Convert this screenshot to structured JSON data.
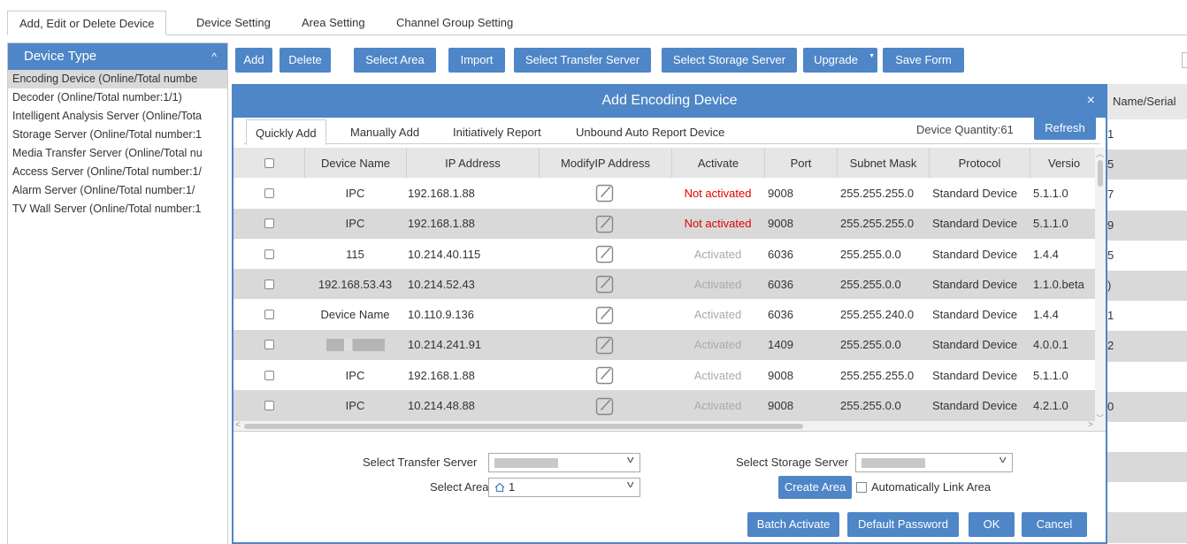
{
  "top_tabs": [
    "Add, Edit or Delete Device",
    "Device Setting",
    "Area Setting",
    "Channel Group Setting"
  ],
  "left_panel": {
    "title": "Device Type",
    "items": [
      "Encoding Device (Online/Total numbe",
      "Decoder (Online/Total number:1/1)",
      "Intelligent Analysis Server (Online/Tota",
      "Storage Server (Online/Total number:1",
      "Media Transfer Server (Online/Total nu",
      "Access Server (Online/Total number:1/",
      "Alarm Server (Online/Total number:1/",
      "TV Wall Server (Online/Total number:1"
    ]
  },
  "toolbar": {
    "add": "Add",
    "delete": "Delete",
    "select_area": "Select Area",
    "import": "Import",
    "select_transfer_server": "Select Transfer Server",
    "select_storage_server": "Select Storage Server",
    "upgrade": "Upgrade",
    "save_form": "Save Form"
  },
  "background_table": {
    "header": "Name/Serial",
    "rows": [
      "1",
      "5",
      "7",
      "9",
      "5",
      ")",
      "1",
      "2",
      "",
      "0"
    ]
  },
  "dialog": {
    "title": "Add  Encoding Device",
    "close": "×",
    "tabs": [
      "Quickly Add",
      "Manually Add",
      "Initiatively Report",
      "Unbound Auto Report Device"
    ],
    "device_quantity": "Device Quantity:61",
    "refresh": "Refresh",
    "columns": [
      "Device Name",
      "IP Address",
      "ModifyIP Address",
      "Activate",
      "Port",
      "Subnet Mask",
      "Protocol",
      "Versio"
    ],
    "rows": [
      {
        "name": "IPC",
        "ip": "192.168.1.88",
        "activate": "Not activated",
        "active": false,
        "port": "9008",
        "mask": "255.255.255.0",
        "protocol": "Standard Device",
        "version": "5.1.1.0"
      },
      {
        "name": "IPC",
        "ip": "192.168.1.88",
        "activate": "Not activated",
        "active": false,
        "port": "9008",
        "mask": "255.255.255.0",
        "protocol": "Standard Device",
        "version": "5.1.1.0"
      },
      {
        "name": "115",
        "ip": "10.214.40.115",
        "activate": "Activated",
        "active": true,
        "port": "6036",
        "mask": "255.255.0.0",
        "protocol": "Standard Device",
        "version": "1.4.4"
      },
      {
        "name": "192.168.53.43",
        "ip": "10.214.52.43",
        "activate": "Activated",
        "active": true,
        "port": "6036",
        "mask": "255.255.0.0",
        "protocol": "Standard Device",
        "version": "1.1.0.beta"
      },
      {
        "name": "Device Name",
        "ip": "10.110.9.136",
        "activate": "Activated",
        "active": true,
        "port": "6036",
        "mask": "255.255.240.0",
        "protocol": "Standard Device",
        "version": "1.4.4"
      },
      {
        "name": "",
        "ip": "10.214.241.91",
        "activate": "Activated",
        "active": true,
        "port": "1409",
        "mask": "255.255.0.0",
        "protocol": "Standard Device",
        "version": "4.0.0.1"
      },
      {
        "name": "IPC",
        "ip": "192.168.1.88",
        "activate": "Activated",
        "active": true,
        "port": "9008",
        "mask": "255.255.255.0",
        "protocol": "Standard Device",
        "version": "5.1.1.0"
      },
      {
        "name": "IPC",
        "ip": "10.214.48.88",
        "activate": "Activated",
        "active": true,
        "port": "9008",
        "mask": "255.255.0.0",
        "protocol": "Standard Device",
        "version": "4.2.1.0"
      }
    ],
    "form": {
      "transfer_label": "Select Transfer Server",
      "storage_label": "Select Storage Server",
      "area_label": "Select Area",
      "area_value": "1",
      "create_area": "Create Area",
      "auto_link": "Automatically Link Area"
    },
    "buttons": {
      "batch_activate": "Batch Activate",
      "default_password": "Default Password",
      "ok": "OK",
      "cancel": "Cancel"
    }
  },
  "colors": {
    "accent": "#4e86c7",
    "row_alt": "#d9d9d9",
    "not_activated": "#e00000",
    "activated": "#aaaaaa"
  }
}
